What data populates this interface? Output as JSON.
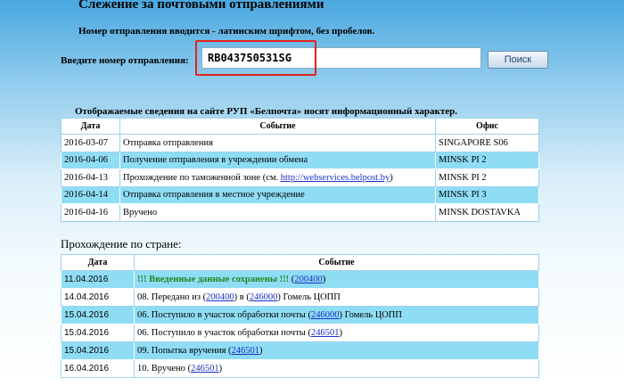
{
  "header": {
    "title": "Слежение за почтовыми отправлениями",
    "hint": "Номер отправления вводится - латинским шрифтом, без пробелов."
  },
  "search": {
    "label": "Введите номер отправления:",
    "value": "RB043750531SG",
    "button_label": "Поиск"
  },
  "info_note": "Отображаемые сведения на сайте РУП «Белпочта» носят информационный характер.",
  "international": {
    "headers": {
      "date": "Дата",
      "event": "Событие",
      "office": "Офис"
    },
    "rows": [
      {
        "date": "2016-03-07",
        "event": "Отправка отправления",
        "office": "SINGAPORE S06"
      },
      {
        "date": "2016-04-06",
        "event": "Получение отправления в учреждении обмена",
        "office": "MINSK PI 2"
      },
      {
        "date": "2016-04-13",
        "event_prefix": "Прохождение по таможенной зоне (см. ",
        "event_link": "http://webservices.belpost.by",
        "event_suffix": ")",
        "office": "MINSK PI 2"
      },
      {
        "date": "2016-04-14",
        "event": "Отправка отправления в местное учреждение",
        "office": "MINSK PI 3"
      },
      {
        "date": "2016-04-16",
        "event": "Вручено",
        "office": "MINSK DOSTAVKA"
      }
    ]
  },
  "domestic": {
    "title": "Прохождение по стране:",
    "headers": {
      "date": "Дата",
      "event": "Событие"
    },
    "rows": [
      {
        "date": "11.04.2016",
        "event_saved": "!!! Введенные данные сохранены !!!",
        "link1": "200400"
      },
      {
        "date": "14.04.2016",
        "event_prefix": "08. Передано из ",
        "link1": "200400",
        "mid": " в ",
        "link2": "246000",
        "event_suffix": " Гомель ЦОПП"
      },
      {
        "date": "15.04.2016",
        "event_prefix": "06. Поступило в участок обработки почты ",
        "link1": "246000",
        "event_suffix": " Гомель ЦОПП"
      },
      {
        "date": "15.04.2016",
        "event_prefix": "06. Поступило в участок обработки почты ",
        "link1": "246501"
      },
      {
        "date": "15.04.2016",
        "event_prefix": "09. Попытка вручения ",
        "link1": "246501"
      },
      {
        "date": "16.04.2016",
        "event_prefix": "10. Вручено ",
        "link1": "246501"
      }
    ]
  }
}
